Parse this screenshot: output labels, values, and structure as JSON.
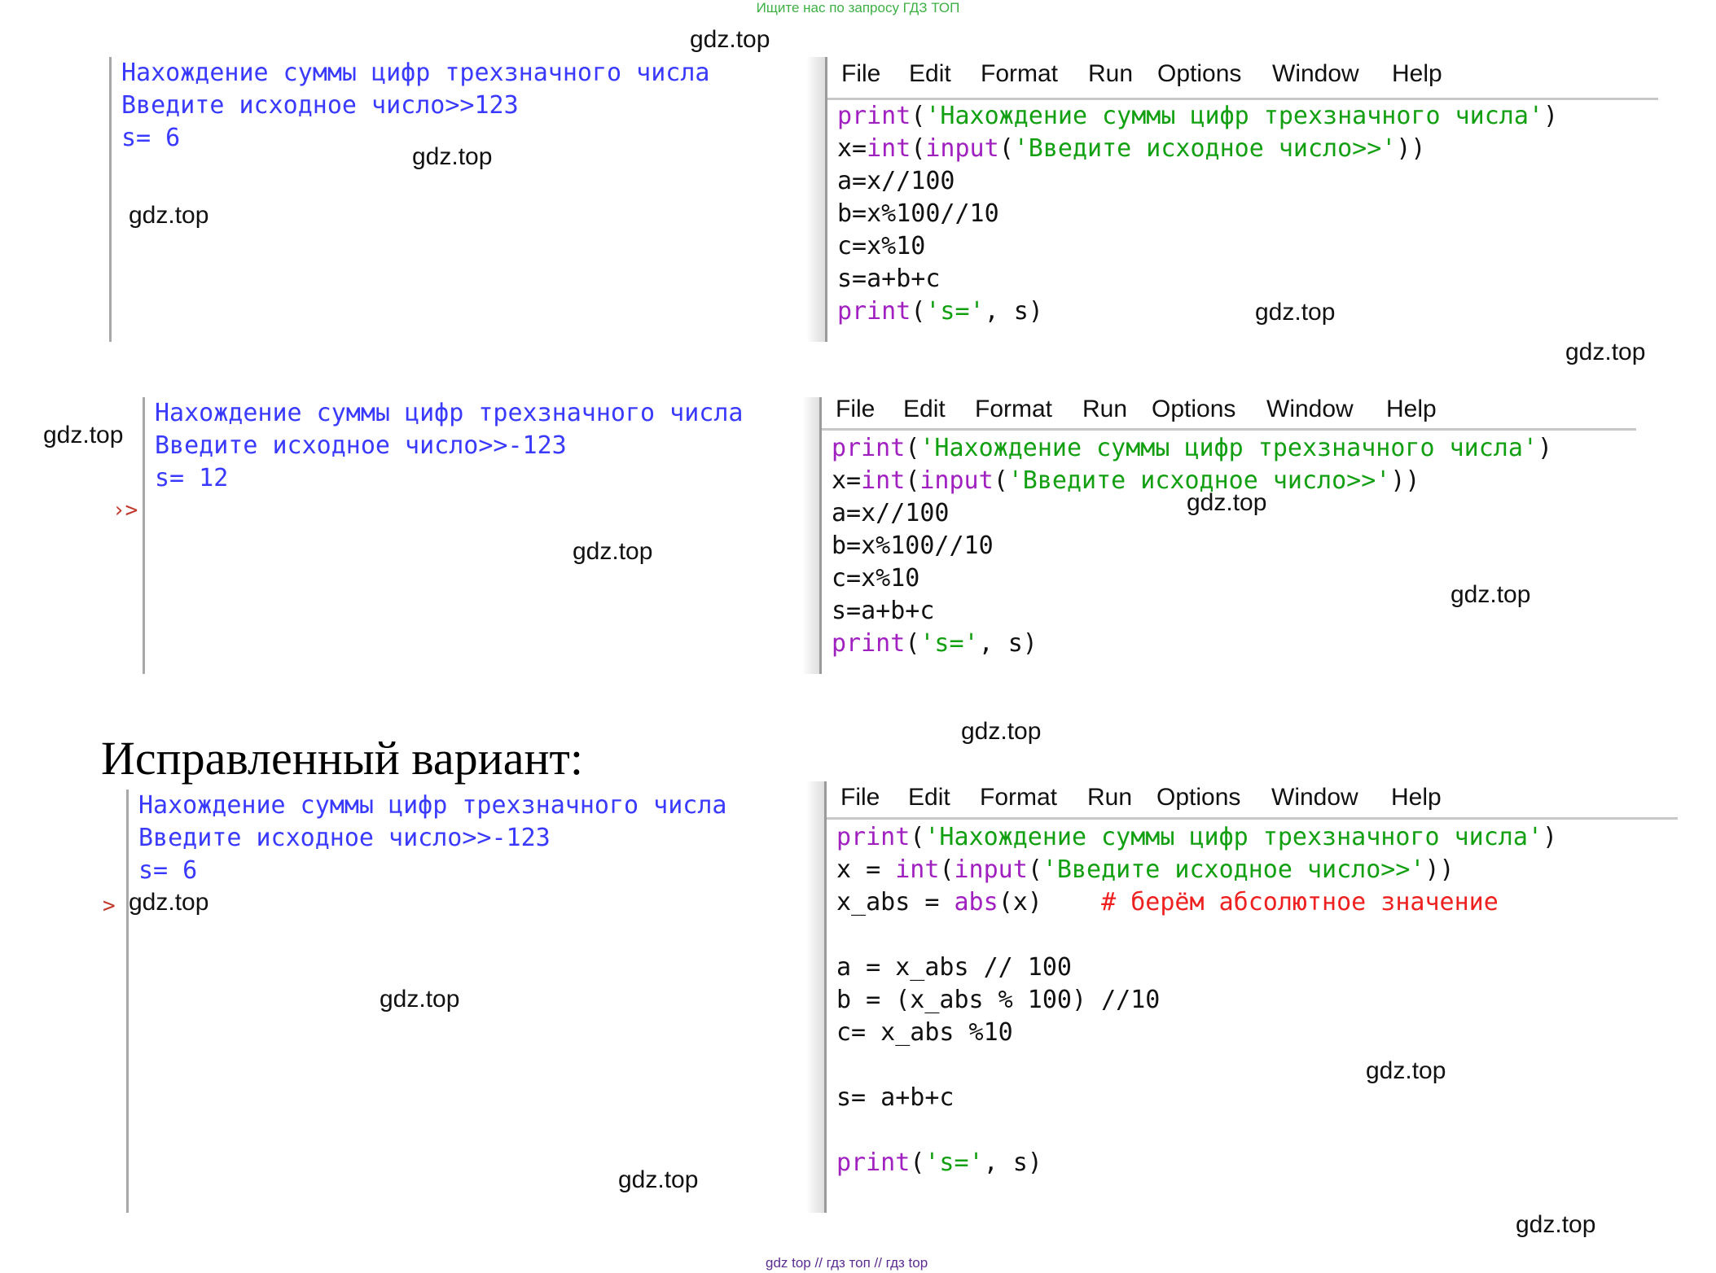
{
  "banner": "Ищите нас по запросу ГДЗ ТОП",
  "watermark": "gdz.top",
  "footer": "gdz top  //  гдз топ  //  гдз top",
  "heading": "Исправленный вариант:",
  "menu": [
    "File",
    "Edit",
    "Format",
    "Run",
    "Options",
    "Window",
    "Help"
  ],
  "panel1": {
    "shell": [
      "Нахождение суммы цифр трехзначного числа",
      "Введите исходное число>>123",
      "s= 6"
    ],
    "code": {
      "l1_kw": "print",
      "l1_a": "(",
      "l1_str": "'Нахождение суммы цифр трехзначного числа'",
      "l1_b": ")",
      "l2_a": "x=",
      "l2_kw1": "int",
      "l2_b": "(",
      "l2_kw2": "input",
      "l2_c": "(",
      "l2_str": "'Введите исходное число>>'",
      "l2_d": "))",
      "l3": "a=x//100",
      "l4": "b=x%100//10",
      "l5": "c=x%10",
      "l6": "s=a+b+c",
      "l7_kw": "print",
      "l7_a": "(",
      "l7_str": "'s='",
      "l7_b": ", s)"
    }
  },
  "panel2": {
    "shell": [
      "Нахождение суммы цифр трехзначного числа",
      "Введите исходное число>>-123",
      "s= 12"
    ],
    "prompt": "›>",
    "code": {
      "l1_kw": "print",
      "l1_a": "(",
      "l1_str": "'Нахождение суммы цифр трехзначного числа'",
      "l1_b": ")",
      "l2_a": "x=",
      "l2_kw1": "int",
      "l2_b": "(",
      "l2_kw2": "input",
      "l2_c": "(",
      "l2_str": "'Введите исходное число>>'",
      "l2_d": "))",
      "l3": "a=x//100",
      "l4": "b=x%100//10",
      "l5": "c=x%10",
      "l6": "s=a+b+c",
      "l7_kw": "print",
      "l7_a": "(",
      "l7_str": "'s='",
      "l7_b": ", s)"
    }
  },
  "panel3": {
    "shell": [
      "Нахождение суммы цифр трехзначного числа",
      "Введите исходное число>>-123",
      "s= 6"
    ],
    "prompt": ">",
    "code": {
      "l1_kw": "print",
      "l1_a": "(",
      "l1_str": "'Нахождение суммы цифр трехзначного числа'",
      "l1_b": ")",
      "l2_a": "x = ",
      "l2_kw1": "int",
      "l2_b": "(",
      "l2_kw2": "input",
      "l2_c": "(",
      "l2_str": "'Введите исходное число>>'",
      "l2_d": "))",
      "l3_a": "x_abs = ",
      "l3_kw": "abs",
      "l3_b": "(x)    ",
      "l3_cmt": "# берём абсолютное значение",
      "l4": "a = x_abs // 100",
      "l5": "b = (x_abs % 100) //10",
      "l6": "c= x_abs %10",
      "l7": "s= a+b+c",
      "l8_kw": "print",
      "l8_a": "(",
      "l8_str": "'s='",
      "l8_b": ", s)"
    }
  }
}
